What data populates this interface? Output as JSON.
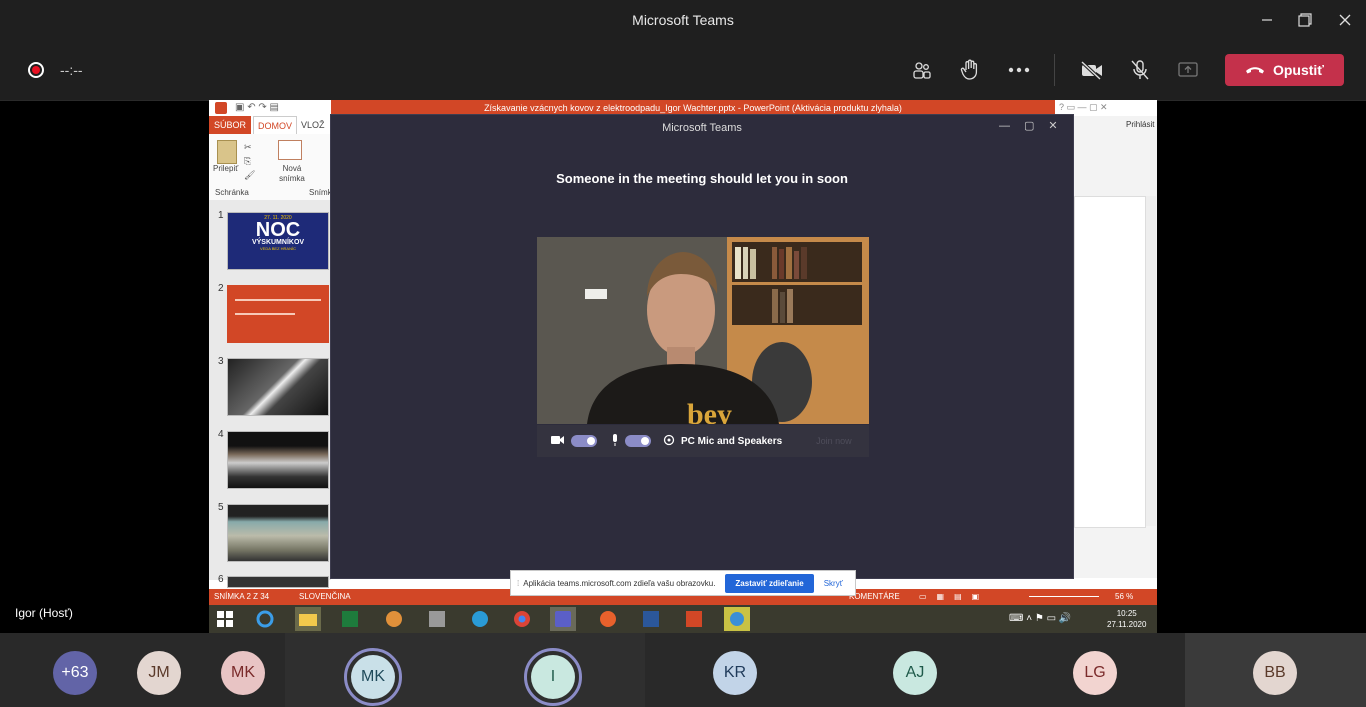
{
  "window": {
    "title": "Microsoft Teams"
  },
  "toolbar": {
    "timer": "--:--",
    "leave_label": "Opustiť"
  },
  "shared_screen": {
    "powerpoint": {
      "window_title": "Získavanie vzácnych kovov z elektroodpadu_Igor Wachter.pptx - PowerPoint (Aktivácia produktu zlyhala)",
      "tabs": [
        "SÚBOR",
        "DOMOV",
        "VLOŽ"
      ],
      "ribbon": {
        "paste_label": "Prilepiť",
        "new_slide_label": "Nová snímka",
        "clipboard_group": "Schránka",
        "slides_group": "Snímk",
        "sign_in": "Prihlásit"
      },
      "slide_numbers": [
        "1",
        "2",
        "3",
        "4",
        "5",
        "6"
      ],
      "slide1": {
        "date": "27. 11. 2020",
        "title_big": "NOC",
        "subtitle": "VÝSKUMNÍKOV",
        "tagline": "VEDA BEZ HRANÍC"
      },
      "status": {
        "slide_info": "SNÍMKA 2 Z 34",
        "language": "SLOVENČINA",
        "comments": "KOMENTÁRE",
        "zoom": "56 %"
      }
    },
    "teams_dialog": {
      "title": "Microsoft Teams",
      "message": "Someone in the meeting should let you in soon",
      "audio_label": "PC Mic and Speakers",
      "join_label": "Join now"
    },
    "share_banner": {
      "text": "Aplikácia teams.microsoft.com zdieľa vašu obrazovku.",
      "stop_label": "Zastaviť zdieľanie",
      "hide_label": "Skryť"
    },
    "taskbar": {
      "time": "10:25",
      "date": "27.11.2020"
    }
  },
  "presenter": {
    "name": "Igor (Hosť)"
  },
  "participants": [
    {
      "initials": "+63",
      "color": "#6264a7"
    },
    {
      "initials": "JM",
      "color": "#e3d6d0"
    },
    {
      "initials": "MK",
      "color": "#e8c4c4"
    },
    {
      "initials": "MK",
      "color": "#c9e0e8"
    },
    {
      "initials": "I",
      "color": "#c9e8e0"
    },
    {
      "initials": "KR",
      "color": "#c2d4e8"
    },
    {
      "initials": "AJ",
      "color": "#c9e8e0"
    },
    {
      "initials": "LG",
      "color": "#f2d4d0"
    },
    {
      "initials": "BB",
      "color": "#e3d6d0"
    }
  ],
  "colors": {
    "leave": "#c4314b",
    "accent": "#6264a7",
    "powerpoint": "#d24726"
  }
}
